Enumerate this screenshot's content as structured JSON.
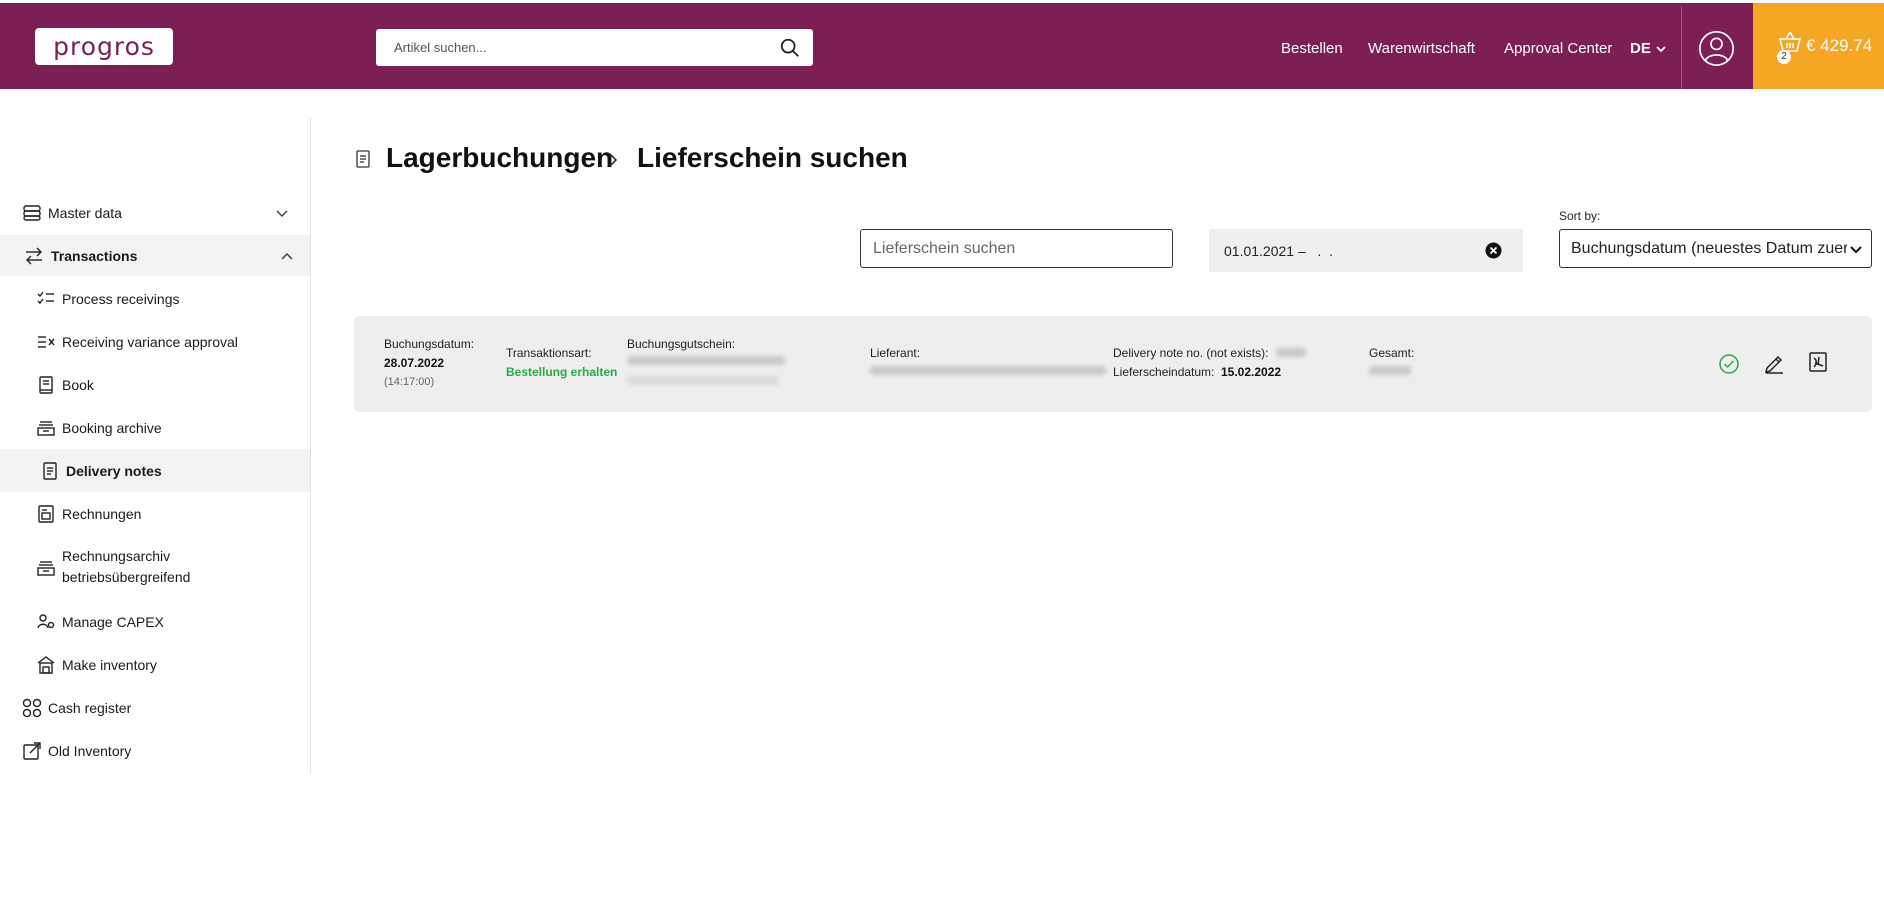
{
  "header": {
    "logo_text": "progros",
    "search_placeholder": "Artikel suchen...",
    "nav": [
      "Bestellen",
      "Warenwirtschaft",
      "Approval Center"
    ],
    "language": "DE",
    "cart_count": "2",
    "cart_amount": "€ 429.74"
  },
  "sidebar": {
    "items": [
      {
        "label": "Master data",
        "icon": "database-icon",
        "level": 1,
        "expandable": true,
        "expanded": false
      },
      {
        "label": "Transactions",
        "icon": "transfer-arrows-icon",
        "level": 1,
        "expandable": true,
        "expanded": true
      },
      {
        "label": "Process receivings",
        "icon": "checklist-icon",
        "level": 2
      },
      {
        "label": "Receiving variance approval",
        "icon": "list-x-icon",
        "level": 2
      },
      {
        "label": "Book",
        "icon": "book-icon",
        "level": 2
      },
      {
        "label": "Booking archive",
        "icon": "archive-tray-icon",
        "level": 2
      },
      {
        "label": "Delivery notes",
        "icon": "note-icon",
        "level": 2,
        "active": true
      },
      {
        "label": "Rechnungen",
        "icon": "invoice-icon",
        "level": 2
      },
      {
        "label": "Rechnungsarchiv betriebsübergreifend",
        "label_line1": "Rechnungsarchiv",
        "label_line2": "betriebsübergreifend",
        "icon": "archive-tray-icon",
        "level": 2
      },
      {
        "label": "Manage CAPEX",
        "icon": "user-gear-icon",
        "level": 2
      },
      {
        "label": "Make inventory",
        "icon": "warehouse-icon",
        "level": 2
      },
      {
        "label": "Cash register",
        "icon": "grid-circles-icon",
        "level": 1
      },
      {
        "label": "Old Inventory",
        "icon": "external-link-icon",
        "level": 1
      }
    ]
  },
  "main": {
    "breadcrumb": [
      "Lagerbuchungen",
      "Lieferschein suchen"
    ],
    "search_placeholder": "Lieferschein suchen",
    "date_range": "01.01.2021 –   .  .",
    "sort_label": "Sort by:",
    "sort_value": "Buchungsdatum (neuestes Datum zuerst)"
  },
  "results": [
    {
      "booking_date_label": "Buchungsdatum:",
      "booking_date": "28.07.2022",
      "booking_time": "(14:17:00)",
      "transaction_type_label": "Transaktionsart:",
      "transaction_type": "Bestellung erhalten",
      "voucher_label": "Buchungsgutschein:",
      "supplier_label": "Lieferant:",
      "delivery_note_label": "Delivery note no. (not exists):",
      "delivery_date_label": "Lieferscheindatum:",
      "delivery_date": "15.02.2022",
      "total_label": "Gesamt:",
      "actions": [
        "check-circle-icon",
        "edit-pen-icon",
        "pdf-file-icon"
      ]
    }
  ],
  "colors": {
    "brand": "#7b1f54",
    "cart": "#f5a623",
    "success": "#2aa84a"
  }
}
